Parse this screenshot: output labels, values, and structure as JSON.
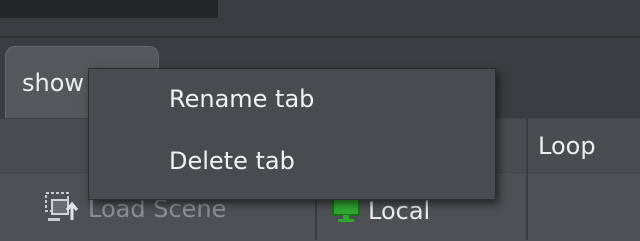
{
  "tab": {
    "label": "show"
  },
  "columns": {
    "loop": "Loop"
  },
  "row": {
    "load_scene": "Load Scene",
    "local": "Local"
  },
  "context_menu": {
    "items": [
      {
        "label": "Rename tab"
      },
      {
        "label": "Delete tab"
      }
    ]
  },
  "icons": {
    "load": "load-scene-icon",
    "local": "monitor-icon"
  },
  "colors": {
    "monitor": "#2fa82f"
  }
}
